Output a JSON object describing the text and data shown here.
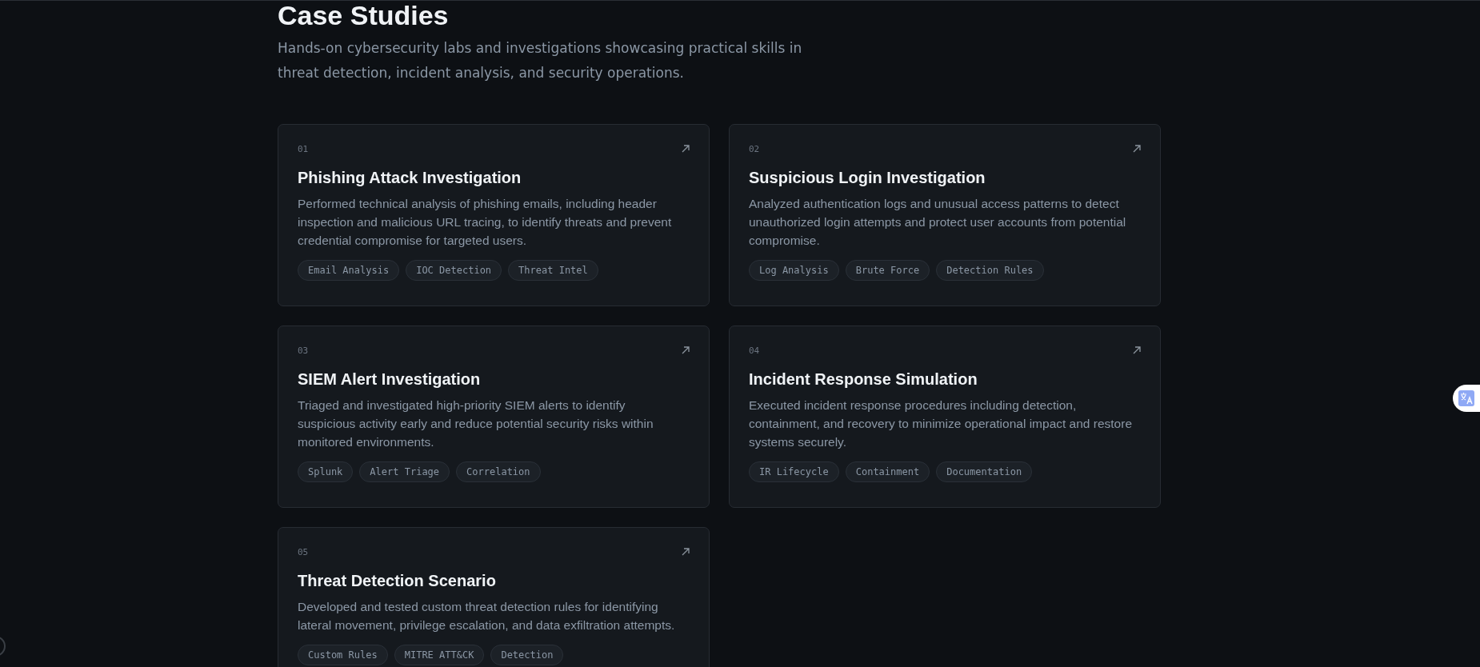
{
  "section": {
    "title": "Case Studies",
    "subtitle": "Hands-on cybersecurity labs and investigations showcasing practical skills in threat detection, incident analysis, and security operations."
  },
  "cards": [
    {
      "number": "01",
      "title": "Phishing Attack Investigation",
      "description": "Performed technical analysis of phishing emails, including header inspection and malicious URL tracing, to identify threats and prevent credential compromise for targeted users.",
      "tags": [
        "Email Analysis",
        "IOC Detection",
        "Threat Intel"
      ]
    },
    {
      "number": "02",
      "title": "Suspicious Login Investigation",
      "description": "Analyzed authentication logs and unusual access patterns to detect unauthorized login attempts and protect user accounts from potential compromise.",
      "tags": [
        "Log Analysis",
        "Brute Force",
        "Detection Rules"
      ]
    },
    {
      "number": "03",
      "title": "SIEM Alert Investigation",
      "description": "Triaged and investigated high-priority SIEM alerts to identify suspicious activity early and reduce potential security risks within monitored environments.",
      "tags": [
        "Splunk",
        "Alert Triage",
        "Correlation"
      ]
    },
    {
      "number": "04",
      "title": "Incident Response Simulation",
      "description": "Executed incident response procedures including detection, containment, and recovery to minimize operational impact and restore systems securely.",
      "tags": [
        "IR Lifecycle",
        "Containment",
        "Documentation"
      ]
    },
    {
      "number": "05",
      "title": "Threat Detection Scenario",
      "description": "Developed and tested custom threat detection rules for identifying lateral movement, privilege escalation, and data exfiltration attempts.",
      "tags": [
        "Custom Rules",
        "MITRE ATT&CK",
        "Detection"
      ]
    }
  ]
}
